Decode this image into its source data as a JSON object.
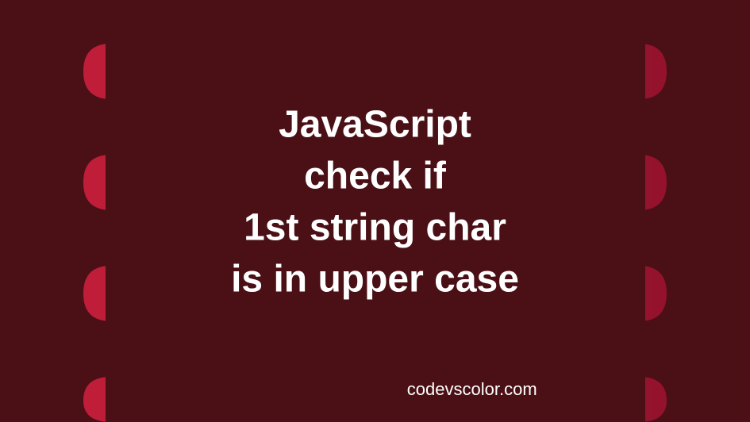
{
  "banner": {
    "title": "JavaScript\ncheck if\n1st string char\nis in upper case",
    "watermark": "codevscolor.com"
  },
  "colors": {
    "gradient_start": "#c41e3a",
    "gradient_end": "#8b1029",
    "panel": "#4a1015",
    "text": "#ffffff"
  }
}
